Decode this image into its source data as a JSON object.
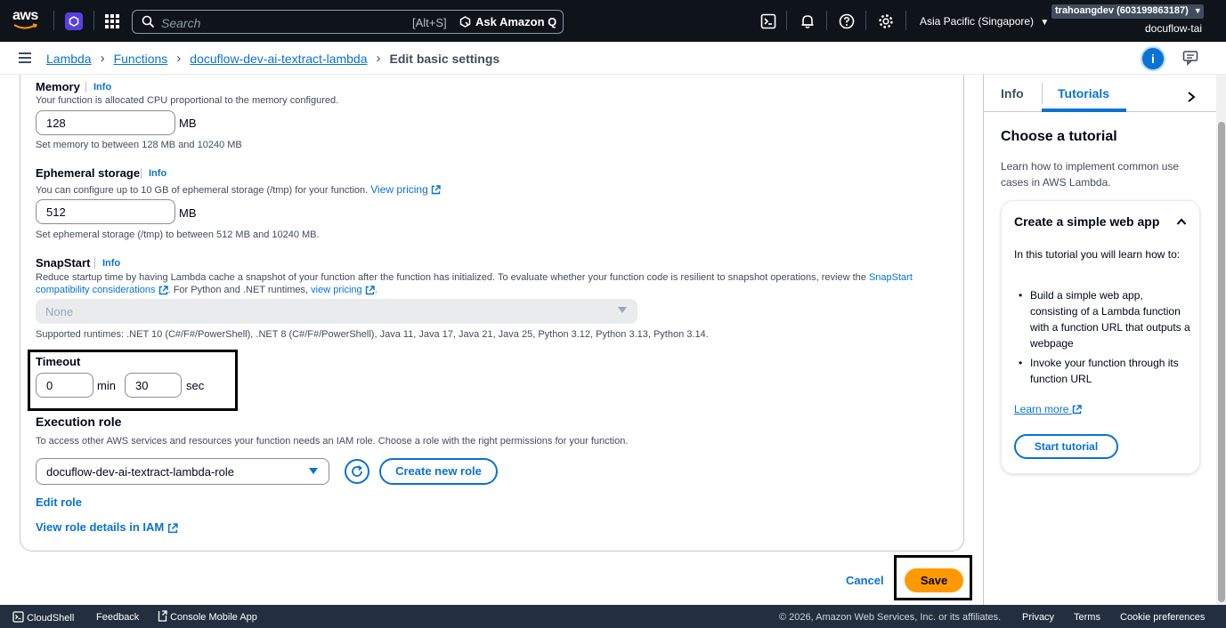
{
  "topnav": {
    "logo_text": "aws",
    "search_placeholder": "Search",
    "search_shortcut": "[Alt+S]",
    "ask_q_label": "Ask Amazon Q",
    "region": "Asia Pacific (Singapore)",
    "account": "trahoangdev (603199863187)",
    "user": "docuflow-tai",
    "icons": [
      "cloudshell-icon",
      "bell-icon",
      "help-icon",
      "settings-icon"
    ]
  },
  "breadcrumb": {
    "items": [
      "Lambda",
      "Functions",
      "docuflow-dev-ai-textract-lambda"
    ],
    "current": "Edit basic settings"
  },
  "form": {
    "memory": {
      "label": "Memory",
      "info": "Info",
      "description": "Your function is allocated CPU proportional to the memory configured.",
      "value": "128",
      "unit": "MB",
      "constraint": "Set memory to between 128 MB and 10240 MB"
    },
    "ephemeral": {
      "label": "Ephemeral storage",
      "info": "Info",
      "description": "You can configure up to 10 GB of ephemeral storage (/tmp) for your function.",
      "pricing_link": "View pricing",
      "value": "512",
      "unit": "MB",
      "constraint": "Set ephemeral storage (/tmp) to between 512 MB and 10240 MB."
    },
    "snapstart": {
      "label": "SnapStart",
      "info": "Info",
      "description_1": "Reduce startup time by having Lambda cache a snapshot of your function after the function has initialized. To evaluate whether your function code is resilient to snapshot operations, review the",
      "link_1a": "SnapStart",
      "link_1b": "compatibility considerations",
      "description_2": ". For Python and .NET runtimes,",
      "link_2": "view pricing",
      "period": ".",
      "select_value": "None",
      "supported": "Supported runtimes: .NET 10 (C#/F#/PowerShell), .NET 8 (C#/F#/PowerShell), Java 11, Java 17, Java 21, Java 25, Python 3.12, Python 3.13, Python 3.14."
    },
    "timeout": {
      "label": "Timeout",
      "min_value": "0",
      "min_unit": "min",
      "sec_value": "30",
      "sec_unit": "sec"
    },
    "role": {
      "label": "Execution role",
      "description": "To access other AWS services and resources your function needs an IAM role. Choose a role with the right permissions for your function.",
      "selected": "docuflow-dev-ai-textract-lambda-role",
      "create_label": "Create new role",
      "edit_label": "Edit role",
      "view_label": "View role details in IAM"
    }
  },
  "actions": {
    "cancel": "Cancel",
    "save": "Save"
  },
  "help_panel": {
    "tab_info": "Info",
    "tab_tutorials": "Tutorials",
    "title": "Choose a tutorial",
    "description": "Learn how to implement common use cases in AWS Lambda.",
    "card": {
      "title": "Create a simple web app",
      "intro": "In this tutorial you will learn how to:",
      "bullets": [
        "Build a simple web app, consisting of a Lambda function with a function URL that outputs a webpage",
        "Invoke your function through its function URL"
      ],
      "learn_more": "Learn more",
      "start": "Start tutorial"
    }
  },
  "footer": {
    "cloudshell": "CloudShell",
    "feedback": "Feedback",
    "mobile": "Console Mobile App",
    "copyright": "© 2026, Amazon Web Services, Inc. or its affiliates.",
    "privacy": "Privacy",
    "terms": "Terms",
    "cookies": "Cookie preferences"
  },
  "colors": {
    "nav_bg": "#0f141a",
    "link": "#0972d3",
    "primary_button": "#ff9900",
    "footer_bg": "#232f3e"
  }
}
